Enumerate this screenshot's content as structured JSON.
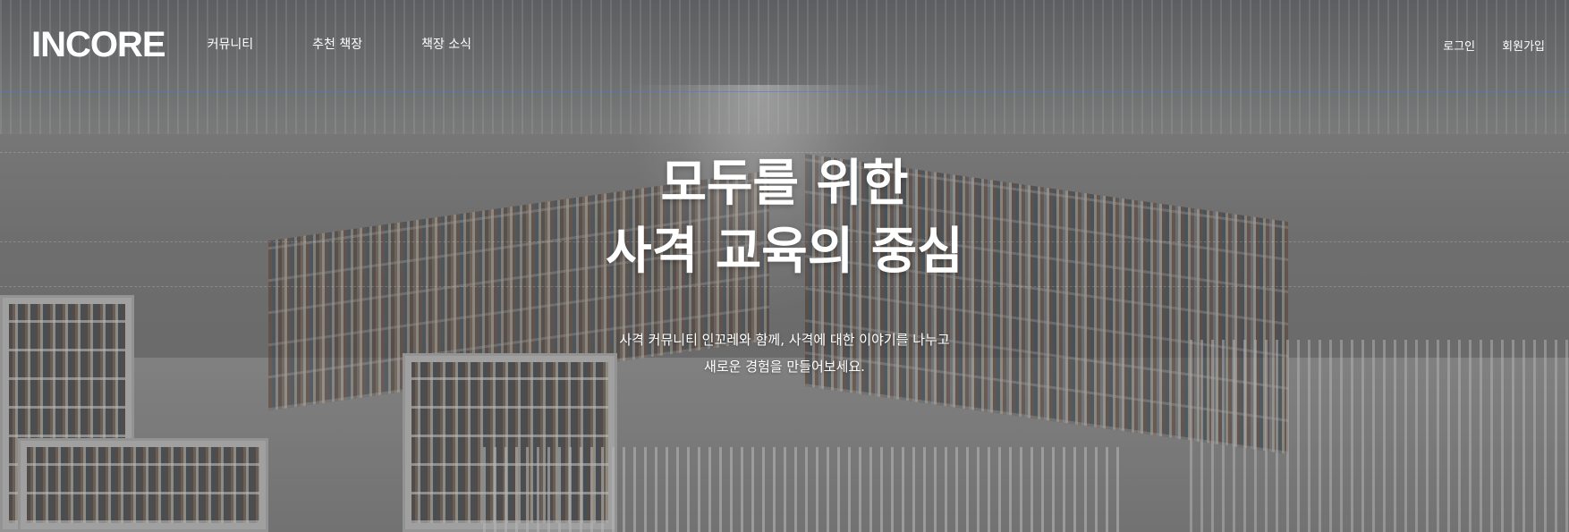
{
  "brand": {
    "logo_text": "INCORE"
  },
  "nav": {
    "menu": [
      {
        "label": "커뮤니티"
      },
      {
        "label": "추천 책장"
      },
      {
        "label": "책장 소식"
      }
    ],
    "auth": {
      "login_label": "로그인",
      "signup_label": "회원가입"
    }
  },
  "hero": {
    "headline_line1": "모두를 위한",
    "headline_line2": "사격 교육의 중심",
    "subtitle_line1": "사격 커뮤니티 인꼬레와 함께, 사격에 대한 이야기를 나누고",
    "subtitle_line2": "새로운 경험을 만들어보세요.",
    "background_image": "library-bookshelves-photo"
  },
  "colors": {
    "text": "#ffffff",
    "overlay": "#282828"
  }
}
